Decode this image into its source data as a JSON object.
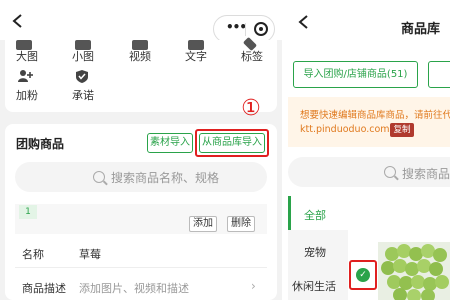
{
  "left": {
    "formats": {
      "row1": [
        "大图",
        "小图",
        "视频",
        "文字",
        "标签"
      ],
      "row2": [
        "加粉",
        "承诺"
      ]
    },
    "group": {
      "title": "团购商品",
      "material_import": "素材导入",
      "library_import": "从商品库导入",
      "callout": "①",
      "search_placeholder": "搜索商品名称、规格",
      "item_index": "1",
      "add": "添加",
      "delete": "删除",
      "name_label": "名称",
      "name_value": "草莓",
      "desc_label": "商品描述",
      "desc_placeholder": "添加图片、视频和描述"
    }
  },
  "right": {
    "title": "商品库",
    "import_button": "导入团购/店铺商品(51)",
    "notice_line1": "想要快速编辑商品库商品，请前往代",
    "notice_line2": "ktt.pinduoduo.com",
    "copy": "复制",
    "search_placeholder": "搜索商品名",
    "categories": [
      "全部",
      "宠物",
      "休闲生活"
    ]
  },
  "colors": {
    "accent": "#2aa34a",
    "highlight": "#e02020",
    "notice_text": "#e07a1f"
  }
}
